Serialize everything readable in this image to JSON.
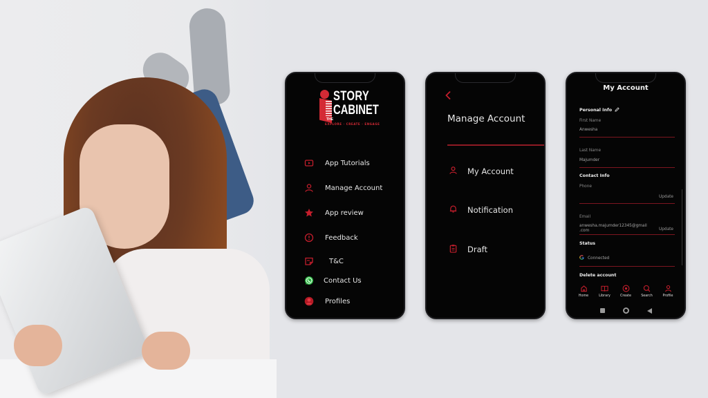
{
  "colors": {
    "accent": "#c41e2c",
    "background": "#e4e5e9",
    "phone_bg": "#050505",
    "text": "#e8e8e8"
  },
  "photo": {
    "description": "Smiling woman lying on bed reading a tablet"
  },
  "phone1": {
    "logo": {
      "the": "THE",
      "line1": "STORY",
      "line2": "CABINET",
      "tagline": "EXPLORE · CREATE · ENGAGE"
    },
    "menu": [
      {
        "label": "App Tutorials",
        "icon": "video-play-icon"
      },
      {
        "label": "Manage Account",
        "icon": "user-icon"
      },
      {
        "label": "App review",
        "icon": "star-icon"
      },
      {
        "label": "Feedback",
        "icon": "alert-circle-icon"
      },
      {
        "label": "T&C",
        "icon": "sticky-note-icon"
      },
      {
        "label": "Contact Us",
        "icon": "whatsapp-icon"
      },
      {
        "label": "Profiles",
        "icon": "profile-avatar-icon"
      }
    ]
  },
  "phone2": {
    "back_icon": "chevron-left-icon",
    "title": "Manage Account",
    "menu": [
      {
        "label": "My Account",
        "icon": "user-icon"
      },
      {
        "label": "Notification",
        "icon": "bell-icon"
      },
      {
        "label": "Draft",
        "icon": "clipboard-icon"
      }
    ]
  },
  "phone3": {
    "title": "My Account",
    "personal_info": "Personal Info",
    "first_name_label": "First Name",
    "first_name": "Anwesha",
    "last_name_label": "Last Name",
    "last_name": "Majumder",
    "contact_info": "Contact Info",
    "phone_label": "Phone",
    "phone_value": "",
    "update_label": "Update",
    "email_label": "Email",
    "email_value_line1": "anwesha.majumder12345@gmail",
    "email_value_line2": ".com",
    "status_label": "Status",
    "status_value": "Connected",
    "delete_account": "Delete account",
    "tabs": [
      {
        "label": "Home",
        "icon": "home-icon"
      },
      {
        "label": "Library",
        "icon": "book-icon"
      },
      {
        "label": "Create",
        "icon": "create-circle-icon"
      },
      {
        "label": "Search",
        "icon": "search-icon"
      },
      {
        "label": "Profile",
        "icon": "profile-icon"
      }
    ]
  }
}
